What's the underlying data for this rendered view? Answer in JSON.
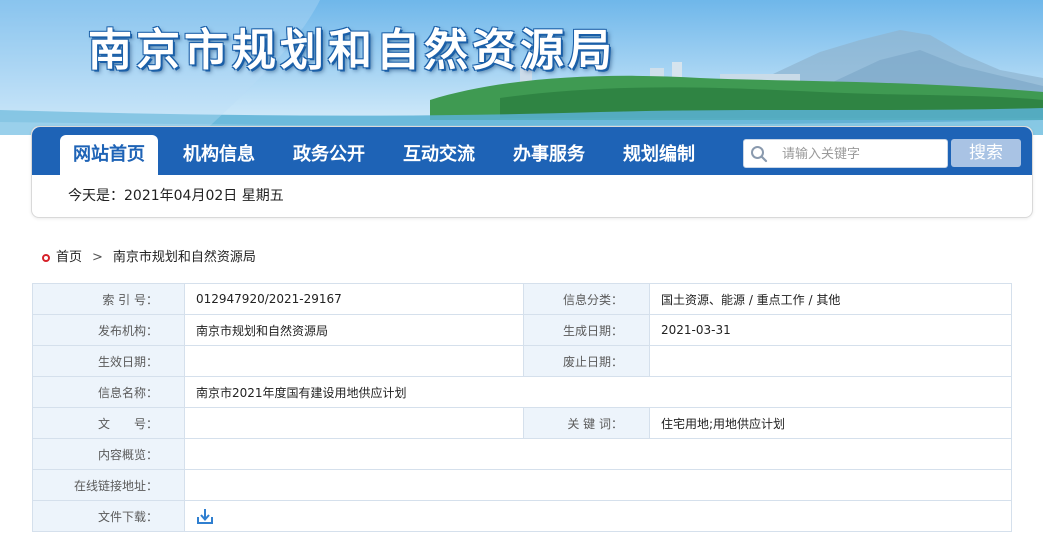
{
  "header": {
    "site_title": "南京市规划和自然资源局"
  },
  "nav": {
    "items": [
      {
        "label": "网站首页",
        "active": true
      },
      {
        "label": "机构信息"
      },
      {
        "label": "政务公开"
      },
      {
        "label": "互动交流"
      },
      {
        "label": "办事服务"
      },
      {
        "label": "规划编制"
      }
    ],
    "search_placeholder": "请输入关键字",
    "search_button": "搜索"
  },
  "date_line": "今天是：2021年04月02日 星期五",
  "breadcrumb": {
    "home": "首页",
    "separator": ">",
    "current": "南京市规划和自然资源局"
  },
  "info": {
    "index_label": "索 引 号：",
    "index_value": "012947920/2021-29167",
    "category_label": "信息分类：",
    "category_value": "国土资源、能源 / 重点工作 / 其他",
    "publisher_label": "发布机构：",
    "publisher_value": "南京市规划和自然资源局",
    "created_label": "生成日期：",
    "created_value": "2021-03-31",
    "effective_label": "生效日期：",
    "effective_value": "",
    "expiry_label": "废止日期：",
    "expiry_value": "",
    "name_label": "信息名称：",
    "name_value": "南京市2021年度国有建设用地供应计划",
    "docno_label": "文　　号：",
    "docno_value": "",
    "keywords_label": "关 键 词：",
    "keywords_value": "住宅用地;用地供应计划",
    "summary_label": "内容概览：",
    "summary_value": "",
    "link_label": "在线链接地址：",
    "link_value": "",
    "download_label": "文件下载："
  },
  "colors": {
    "nav_blue": "#1e63b6",
    "label_bg": "#edf4fb",
    "border": "#d5e0ec"
  },
  "icons": {
    "search": "magnifier-icon",
    "download": "download-icon",
    "breadcrumb": "red-dot-icon"
  }
}
